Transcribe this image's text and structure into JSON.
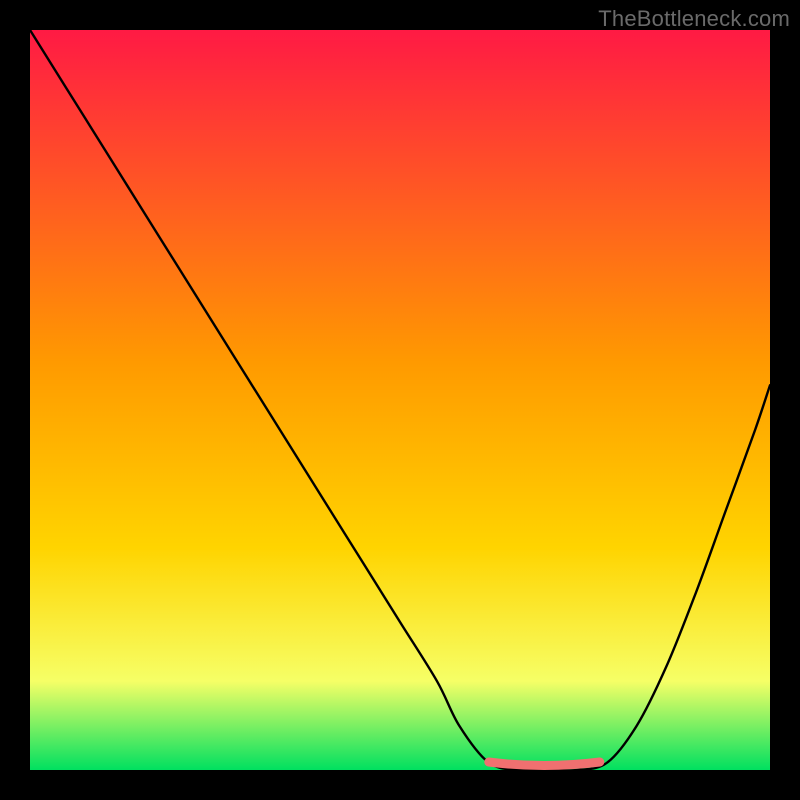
{
  "watermark": "TheBottleneck.com",
  "colors": {
    "background": "#000000",
    "gradient_top": "#ff1a44",
    "gradient_mid": "#ffd400",
    "gradient_low": "#f6ff66",
    "gradient_bottom": "#00e060",
    "curve": "#000000",
    "marker": "#f07070"
  },
  "chart_data": {
    "type": "line",
    "title": "",
    "xlabel": "",
    "ylabel": "",
    "xlim": [
      0,
      100
    ],
    "ylim": [
      0,
      100
    ],
    "grid": false,
    "legend": false,
    "series": [
      {
        "name": "bottleneck-curve",
        "x": [
          0,
          5,
          10,
          15,
          20,
          25,
          30,
          35,
          40,
          45,
          50,
          55,
          58,
          62,
          66,
          70,
          74,
          78,
          82,
          86,
          90,
          94,
          98,
          100
        ],
        "y": [
          100,
          92,
          84,
          76,
          68,
          60,
          52,
          44,
          36,
          28,
          20,
          12,
          6,
          1,
          0,
          0,
          0,
          1,
          6,
          14,
          24,
          35,
          46,
          52
        ]
      }
    ],
    "annotations": [
      {
        "name": "optimal-range-marker",
        "x_start": 62,
        "x_end": 77,
        "y": 0
      }
    ]
  }
}
